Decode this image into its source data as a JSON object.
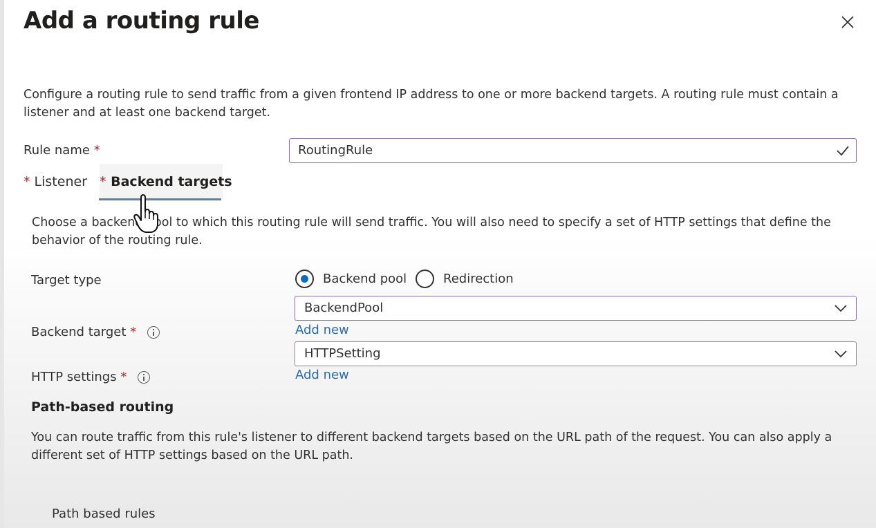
{
  "dialog": {
    "title": "Add a routing rule",
    "description": "Configure a routing rule to send traffic from a given frontend IP address to one or more backend targets. A routing rule must contain a listener and at least one backend target."
  },
  "rule_name": {
    "label": "Rule name",
    "required_mark": "*",
    "value": "RoutingRule"
  },
  "tabs": [
    {
      "required_mark": "*",
      "label": "Listener",
      "active": false
    },
    {
      "required_mark": "*",
      "label": "Backend targets",
      "active": true
    }
  ],
  "backend_targets": {
    "description": "Choose a backend pool to which this routing rule will send traffic. You will also need to specify a set of HTTP settings that define the behavior of the routing rule.",
    "target_type": {
      "label": "Target type",
      "options": [
        {
          "label": "Backend pool",
          "selected": true
        },
        {
          "label": "Redirection",
          "selected": false
        }
      ]
    },
    "backend_target": {
      "label": "Backend target",
      "required_mark": "*",
      "value": "BackendPool",
      "add_new": "Add new"
    },
    "http_settings": {
      "label": "HTTP settings",
      "required_mark": "*",
      "value": "HTTPSetting",
      "add_new": "Add new"
    }
  },
  "path_based_routing": {
    "title": "Path-based routing",
    "description": "You can route traffic from this rule's listener to different backend targets based on the URL path of the request. You can also apply a different set of HTTP settings based on the URL path.",
    "rules_label": "Path based rules"
  },
  "colors": {
    "accent": "#0f6cbd",
    "link": "#2b6cb0",
    "tab_underline": "#4a83c6",
    "focus_border": "#8a6fae",
    "required": "#a4262c"
  }
}
